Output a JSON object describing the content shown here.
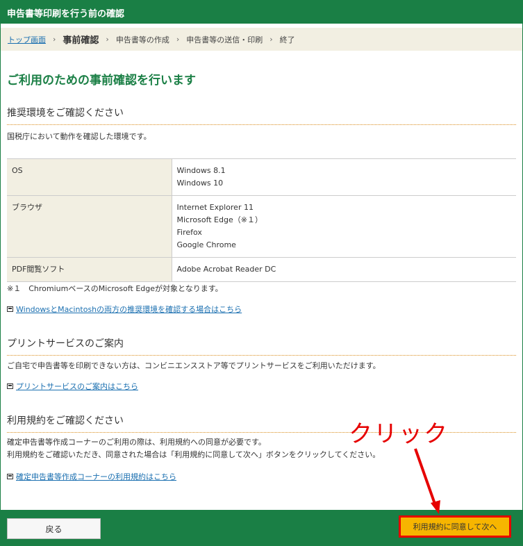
{
  "header": {
    "title": "申告書等印刷を行う前の確認"
  },
  "breadcrumb": {
    "home": "トップ画面",
    "current": "事前確認",
    "steps": [
      "申告書等の作成",
      "申告書等の送信・印刷",
      "終了"
    ]
  },
  "main_title": "ご利用のための事前確認を行います",
  "env": {
    "title": "推奨環境をご確認ください",
    "intro": "国税庁において動作を確認した環境です。",
    "rows": [
      {
        "label": "OS",
        "values": [
          "Windows 8.1",
          "Windows 10"
        ]
      },
      {
        "label": "ブラウザ",
        "values": [
          "Internet Explorer 11",
          "Microsoft Edge（※１）",
          "Firefox",
          "Google Chrome"
        ]
      },
      {
        "label": "PDF閲覧ソフト",
        "values": [
          "Adobe Acrobat Reader DC"
        ]
      }
    ],
    "note": "※１　ChromiumベースのMicrosoft Edgeが対象となります。",
    "link": "WindowsとMacintoshの両方の推奨環境を確認する場合はこちら"
  },
  "print_service": {
    "title": "プリントサービスのご案内",
    "text": "ご自宅で申告書等を印刷できない方は、コンビニエンスストア等でプリントサービスをご利用いただけます。",
    "link": "プリントサービスのご案内はこちら"
  },
  "terms": {
    "title": "利用規約をご確認ください",
    "line1": "確定申告書等作成コーナーのご利用の際は、利用規約への同意が必要です。",
    "line2": "利用規約をご確認いただき、同意された場合は「利用規約に同意して次へ」ボタンをクリックしてください。",
    "link": "確定申告書等作成コーナーの利用規約はこちら"
  },
  "footer": {
    "back_label": "戻る",
    "agree_label": "利用規約に同意して次へ"
  },
  "annotation": {
    "text": "クリック",
    "color": "#e60000"
  },
  "colors": {
    "brand": "#1a7f45",
    "accent": "#f7b500",
    "highlight": "#e60000"
  }
}
